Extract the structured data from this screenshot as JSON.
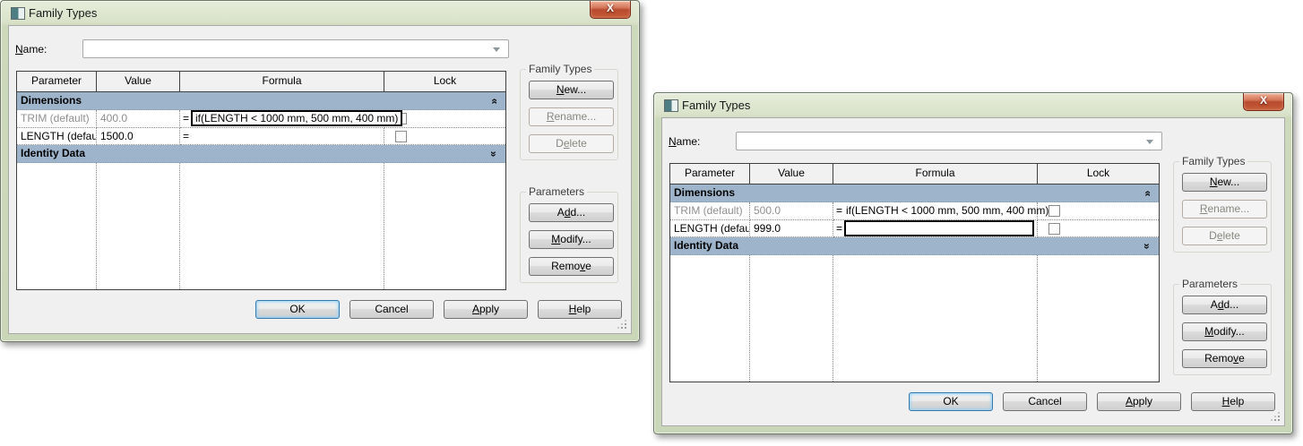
{
  "icons": {
    "close_x": "X",
    "group_chevron": "»",
    "dropdown_arrow": "triangle-down",
    "app_icon": "family-types-window-icon"
  },
  "colors": {
    "frame_green": "#cdd9bb",
    "client_gray": "#f0f0f0",
    "group_row_blue": "#9db4cb",
    "close_red": "#c75c36",
    "focus_blue": "#3579ad"
  },
  "dialogs": [
    {
      "title": "Family Types",
      "name_field": {
        "label": {
          "pre": "",
          "mn": "N",
          "post": "ame:"
        },
        "value": ""
      },
      "table": {
        "headers": [
          "Parameter",
          "Value",
          "Formula",
          "Lock"
        ],
        "group_dimensions": "Dimensions",
        "group_identity": "Identity Data",
        "rows": [
          {
            "parameter": "TRIM (default)",
            "value": "400.0",
            "equals": "=",
            "formula": "if(LENGTH < 1000 mm, 500 mm, 400 mm)"
          },
          {
            "parameter": "LENGTH (defaul",
            "value": "1500.0",
            "equals": "=",
            "formula": ""
          }
        ]
      },
      "side": {
        "family_types": {
          "title": "Family Types",
          "new": {
            "pre": "",
            "mn": "N",
            "post": "ew..."
          },
          "rename": {
            "pre": "",
            "mn": "R",
            "post": "ename..."
          },
          "delete": {
            "pre": "D",
            "mn": "e",
            "post": "lete"
          }
        },
        "parameters": {
          "title": "Parameters",
          "add": {
            "pre": "A",
            "mn": "d",
            "post": "d..."
          },
          "modify": {
            "pre": "",
            "mn": "M",
            "post": "odify..."
          },
          "remove": {
            "pre": "Remo",
            "mn": "v",
            "post": "e"
          }
        }
      },
      "footer": {
        "ok": {
          "pre": "OK",
          "mn": "",
          "post": ""
        },
        "cancel": {
          "pre": "Cancel",
          "mn": "",
          "post": ""
        },
        "apply": {
          "pre": "",
          "mn": "A",
          "post": "pply"
        },
        "help": {
          "pre": "",
          "mn": "H",
          "post": "elp"
        }
      }
    },
    {
      "title": "Family Types",
      "name_field": {
        "label": {
          "pre": "",
          "mn": "N",
          "post": "ame:"
        },
        "value": ""
      },
      "table": {
        "headers": [
          "Parameter",
          "Value",
          "Formula",
          "Lock"
        ],
        "group_dimensions": "Dimensions",
        "group_identity": "Identity Data",
        "rows": [
          {
            "parameter": "TRIM (default)",
            "value": "500.0",
            "equals": "=",
            "formula": "if(LENGTH < 1000 mm, 500 mm, 400 mm)"
          },
          {
            "parameter": "LENGTH (defaul",
            "value": "999.0",
            "equals": "=",
            "formula": ""
          }
        ]
      },
      "side": {
        "family_types": {
          "title": "Family Types",
          "new": {
            "pre": "",
            "mn": "N",
            "post": "ew..."
          },
          "rename": {
            "pre": "",
            "mn": "R",
            "post": "ename..."
          },
          "delete": {
            "pre": "D",
            "mn": "e",
            "post": "lete"
          }
        },
        "parameters": {
          "title": "Parameters",
          "add": {
            "pre": "A",
            "mn": "d",
            "post": "d..."
          },
          "modify": {
            "pre": "",
            "mn": "M",
            "post": "odify..."
          },
          "remove": {
            "pre": "Remo",
            "mn": "v",
            "post": "e"
          }
        }
      },
      "footer": {
        "ok": {
          "pre": "OK",
          "mn": "",
          "post": ""
        },
        "cancel": {
          "pre": "Cancel",
          "mn": "",
          "post": ""
        },
        "apply": {
          "pre": "",
          "mn": "A",
          "post": "pply"
        },
        "help": {
          "pre": "",
          "mn": "H",
          "post": "elp"
        }
      }
    }
  ]
}
